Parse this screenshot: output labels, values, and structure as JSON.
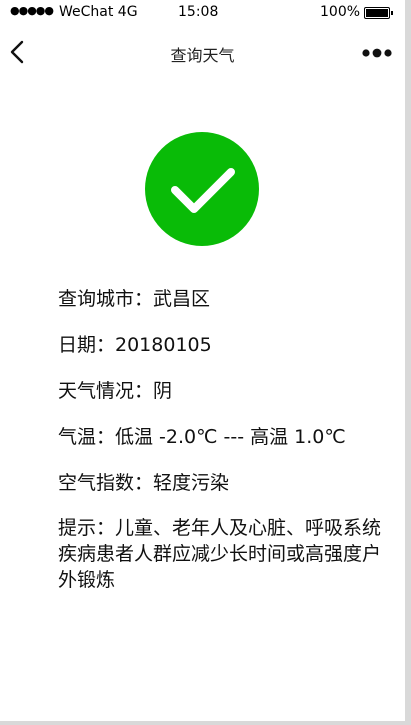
{
  "status_bar": {
    "signal": "●●●●●",
    "carrier": "WeChat 4G",
    "time": "15:08",
    "battery_percent": "100%",
    "battery_level": 1.0
  },
  "nav": {
    "title": "查询天气",
    "back_icon": "chevron-left-icon",
    "more_icon": "more-dots-icon"
  },
  "result": {
    "icon": "check-icon",
    "icon_color": "#09bb07"
  },
  "weather": {
    "city": "查询城市：武昌区",
    "date": "日期：20180105",
    "condition": "天气情况：阴",
    "temperature": "气温：低温 -2.0℃ --- 高温 1.0℃",
    "air_quality": "空气指数：轻度污染",
    "tip": "提示：儿童、老年人及心脏、呼吸系统疾病患者人群应减少长时间或高强度户外锻炼"
  }
}
